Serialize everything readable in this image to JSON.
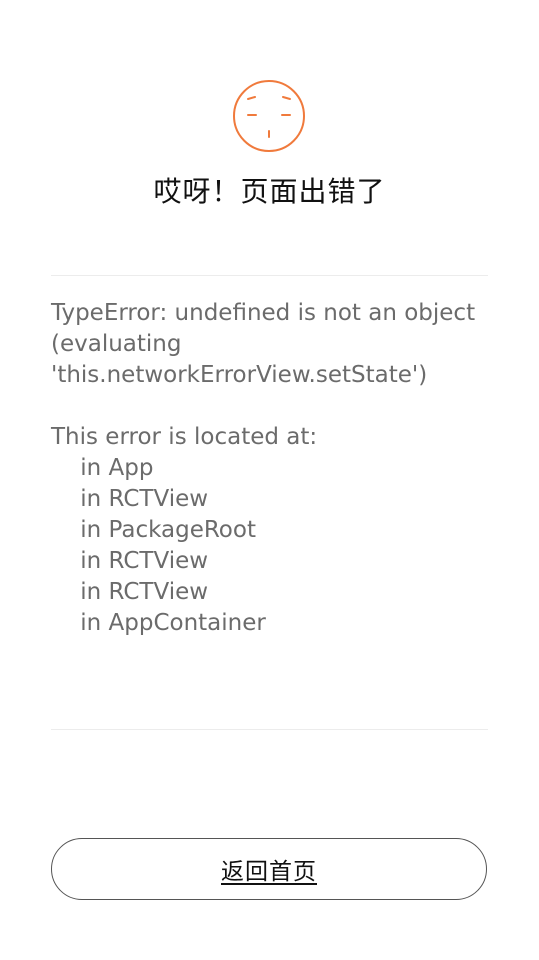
{
  "colors": {
    "accent": "#F07A3C",
    "text_primary": "#111111",
    "text_secondary": "#6B6B6B",
    "divider": "#ECECEC"
  },
  "header": {
    "icon": "sad-face-icon",
    "title": "哎呀！页面出错了"
  },
  "error": {
    "message_lines": [
      "TypeError: undefined is not an object",
      "(evaluating",
      "'this.networkErrorView.setState')",
      "",
      "This error is located at:",
      "    in App",
      "    in RCTView",
      "    in PackageRoot",
      "    in RCTView",
      "    in RCTView",
      "    in AppContainer"
    ]
  },
  "actions": {
    "home_label": "返回首页"
  }
}
